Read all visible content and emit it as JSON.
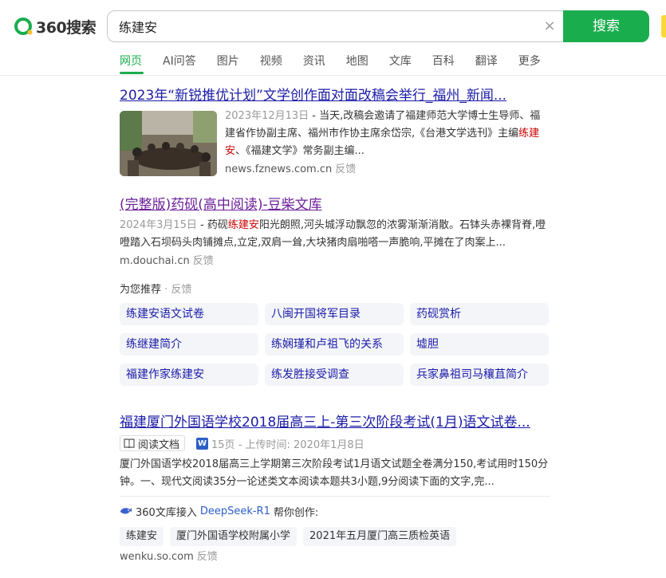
{
  "header": {
    "logo_text": "360搜索",
    "query": "练建安",
    "clear_symbol": "×",
    "search_button": "搜索"
  },
  "tabs": [
    "网页",
    "AI问答",
    "图片",
    "视频",
    "资讯",
    "地图",
    "文库",
    "百科",
    "翻译",
    "更多"
  ],
  "results": [
    {
      "title": "2023年“新锐推优计划”文学创作面对面改稿会举行_福州_新闻...",
      "date": "2023年12月13日",
      "text_before": " - 当天,改稿会邀请了福建师范大学博士生导师、福建省作协副主席、福州市作协主席余岱宗,《台港文学选刊》主编",
      "highlight": "练建安",
      "text_after": "、《福建文学》常务副主编...",
      "url": "news.fznews.com.cn",
      "feedback": "反馈"
    },
    {
      "title": "(完整版)药砚(高中阅读)-豆柴文库",
      "date": "2024年3月15日",
      "text_before": " - 药砚",
      "highlight": "练建安",
      "text_after": "阳光朗照,河头城浮动飘忽的浓雾渐渐消散。石钵头赤裸背脊,噔噔踏入石坝码头肉铺摊点,立定,双肩一耸,大块猪肉扇啪嗒一声脆响,平摊在了肉案上...",
      "url": "m.douchai.cn",
      "feedback": "反馈"
    }
  ],
  "recommend": {
    "title": "为您推荐",
    "separator": "·",
    "feedback": "反馈",
    "items": [
      "练建安语文试卷",
      "八闽开国将军目录",
      "药砚赏析",
      "练继建简介",
      "练娴瑾和卢祖飞的关系",
      "墟胆",
      "福建作家练建安",
      "练发胜接受调查",
      "兵家鼻祖司马穰苴简介"
    ]
  },
  "doc_result": {
    "title": "福建厦门外国语学校2018届高三上-第三次阶段考试(1月)语文试卷...",
    "read_button": "阅读文档",
    "doc_icon": "W",
    "meta": "15页 - 上传时间: 2020年1月8日",
    "text": "厦门外国语学校2018届高三上学期第三次阶段考试1月语文试题全卷满分150,考试用时150分钟。一、现代文阅读35分一论述类文本阅读本题共3小题,9分阅读下面的文字,完...",
    "ai_prefix": "360文库接入",
    "ai_link": "DeepSeek-R1",
    "ai_suffix": "帮你创作:",
    "chips": [
      "练建安",
      "厦门外国语学校附属小学",
      "2021年五月厦门高三质检英语"
    ],
    "url": "wenku.so.com",
    "feedback": "反馈"
  }
}
